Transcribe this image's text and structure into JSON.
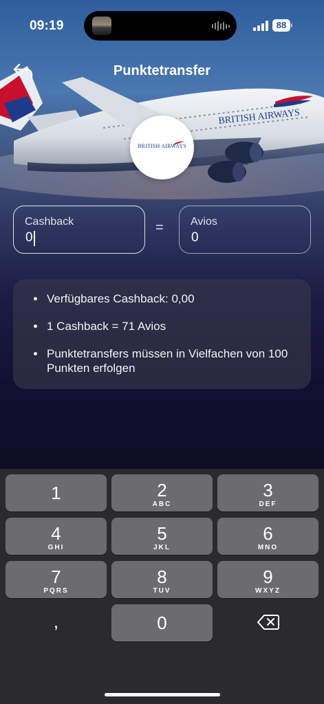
{
  "status_bar": {
    "time": "09:19",
    "battery": "88"
  },
  "header": {
    "title": "Punktetransfer"
  },
  "brand": {
    "logo_text": "BRITISH AIRWAYS",
    "hero_livery_text": "BRITISH AIRWAYS"
  },
  "conversion": {
    "cashback": {
      "label": "Cashback",
      "value": "0"
    },
    "equals": "=",
    "avios": {
      "label": "Avios",
      "value": "0"
    }
  },
  "info": {
    "items": [
      "Verfügbares Cashback: 0,00",
      "1 Cashback = 71 Avios",
      "Punktetransfers müssen in Vielfachen von 100 Punkten erfolgen"
    ]
  },
  "keyboard": {
    "keys": [
      {
        "digit": "1",
        "letters": ""
      },
      {
        "digit": "2",
        "letters": "ABC"
      },
      {
        "digit": "3",
        "letters": "DEF"
      },
      {
        "digit": "4",
        "letters": "GHI"
      },
      {
        "digit": "5",
        "letters": "JKL"
      },
      {
        "digit": "6",
        "letters": "MNO"
      },
      {
        "digit": "7",
        "letters": "PQRS"
      },
      {
        "digit": "8",
        "letters": "TUV"
      },
      {
        "digit": "9",
        "letters": "WXYZ"
      },
      {
        "digit": "0",
        "letters": ""
      }
    ],
    "comma": ",",
    "delete_icon": "delete-backspace-icon"
  },
  "colors": {
    "background": "#0f0d24",
    "keyboard": "#2b2b2f",
    "key": "#6b6b70",
    "brand_blue": "#1d3b8a",
    "brand_red": "#c8102e"
  }
}
